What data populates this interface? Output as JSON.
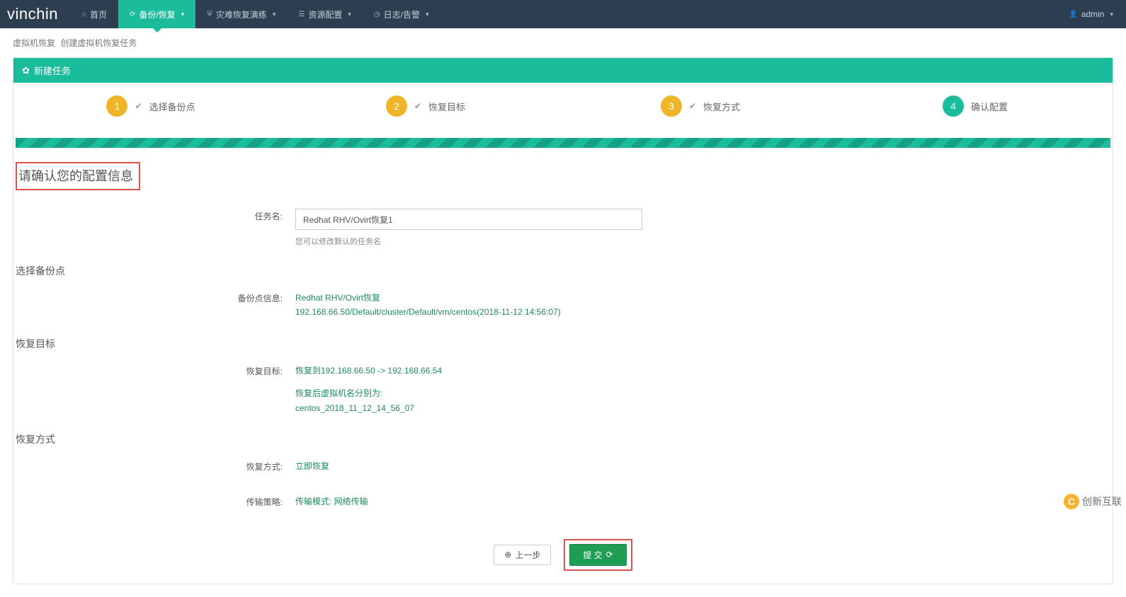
{
  "brand": "vinchin",
  "nav": {
    "home": "首页",
    "backup": "备份/恢复",
    "dr_drill": "灾难恢复演练",
    "resource": "资源配置",
    "log_alert": "日志/告警"
  },
  "user": {
    "name": "admin"
  },
  "breadcrumb": {
    "a": "虚拟机恢复",
    "b": "创建虚拟机恢复任务"
  },
  "panel_title": "新建任务",
  "steps": {
    "s1": {
      "num": "1",
      "label": "选择备份点"
    },
    "s2": {
      "num": "2",
      "label": "恢复目标"
    },
    "s3": {
      "num": "3",
      "label": "恢复方式"
    },
    "s4": {
      "num": "4",
      "label": "确认配置"
    }
  },
  "confirm_title": "请确认您的配置信息",
  "form": {
    "task_name_label": "任务名:",
    "task_name_value": "Redhat RHV/Ovirt恢复1",
    "task_name_hint": "您可以修改默认的任务名"
  },
  "sections": {
    "backup_point_title": "选择备份点",
    "backup_point_label": "备份点信息:",
    "backup_point_line1": "Redhat RHV/Ovirt恢复",
    "backup_point_line2": "192.168.66.50/Default/cluster/Default/vm/centos(2018-11-12 14:56:07)",
    "restore_target_title": "恢复目标",
    "restore_target_label": "恢复目标:",
    "restore_target_line1": "恢复到192.168.66.50 -> 192.168.66.54",
    "restore_target_line2": "恢复后虚拟机名分别为:",
    "restore_target_line3": "centos_2018_11_12_14_56_07",
    "restore_mode_title": "恢复方式",
    "restore_mode_label": "恢复方式:",
    "restore_mode_value": "立即恢复",
    "transport_label": "传输策略:",
    "transport_value": "传输模式: 网络传输"
  },
  "buttons": {
    "prev": "上一步",
    "submit": "提 交"
  },
  "watermark": "创新互联"
}
